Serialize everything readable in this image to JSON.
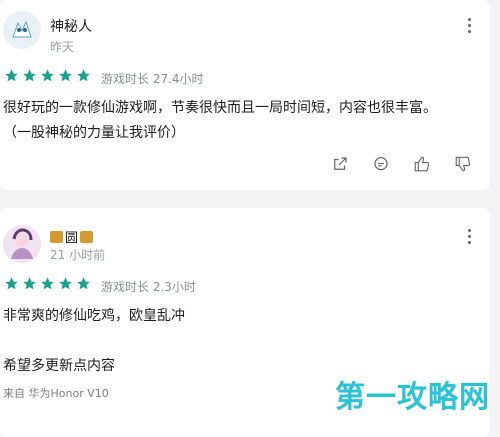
{
  "reviews": [
    {
      "name": "神秘人",
      "time": "昨天",
      "rating": 5,
      "playtime": "游戏时长 27.4小时",
      "content_lines": [
        "很好玩的一款修仙游戏啊，节奏很快而且一局时间短，内容也很丰富。",
        "（一股神秘的力量让我评价）"
      ]
    },
    {
      "name": "圆",
      "time": "21 小时前",
      "rating": 5,
      "playtime": "游戏时长 2.3小时",
      "content_lines": [
        "非常爽的修仙吃鸡，欧皇乱冲",
        "",
        "希望多更新点内容"
      ],
      "device": "来自 华为Honor V10"
    }
  ],
  "watermark": "第一攻略网",
  "colors": {
    "star": "#1aa38a",
    "watermark": "#27c3d6",
    "crown": "#d49b2c"
  },
  "icons": {
    "actions": [
      "share-icon",
      "comment-icon",
      "thumb-up-icon",
      "thumb-down-icon"
    ],
    "menu": "more-vertical-icon"
  }
}
